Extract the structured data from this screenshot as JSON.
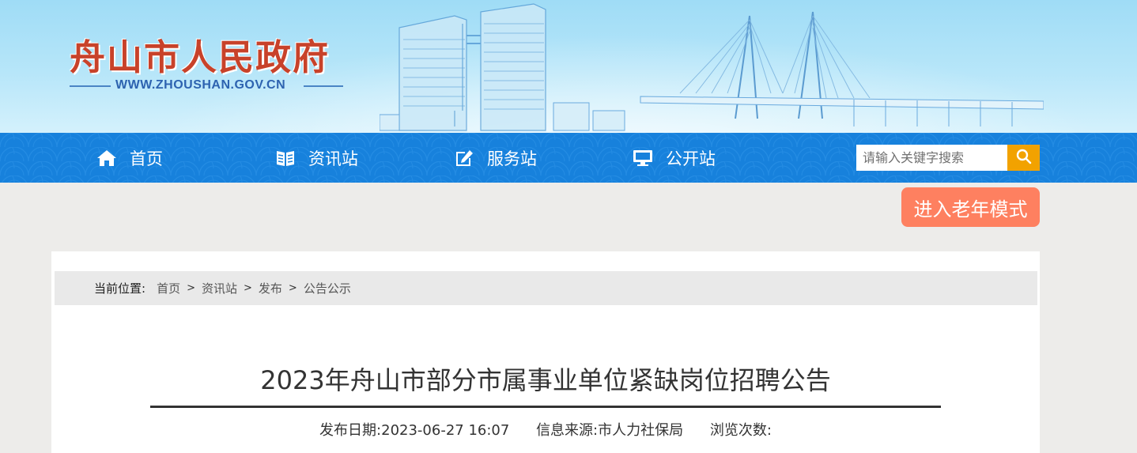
{
  "banner": {
    "site_name": "舟山市人民政府",
    "site_url": "WWW.ZHOUSHAN.GOV.CN"
  },
  "nav": {
    "items": [
      {
        "label": "首页",
        "icon": "home-icon"
      },
      {
        "label": "资讯站",
        "icon": "news-icon"
      },
      {
        "label": "服务站",
        "icon": "edit-icon"
      },
      {
        "label": "公开站",
        "icon": "monitor-icon"
      }
    ]
  },
  "search": {
    "placeholder": "请输入关键字搜索",
    "icon": "search-icon"
  },
  "elder_mode": {
    "label": "进入老年模式"
  },
  "breadcrumb": {
    "title": "当前位置:",
    "items": [
      "首页",
      "资讯站",
      "发布",
      "公告公示"
    ],
    "separator": ">"
  },
  "article": {
    "title": "2023年舟山市部分市属事业单位紧缺岗位招聘公告",
    "meta": {
      "date_label": "发布日期:",
      "date_value": "2023-06-27 16:07",
      "source_label": "信息来源:",
      "source_value": "市人力社保局",
      "views_label": "浏览次数:"
    }
  },
  "colors": {
    "nav_blue": "#1781dc",
    "search_button": "#f2a200",
    "elder_button": "#fe8060",
    "logo_red": "#c8422a"
  }
}
